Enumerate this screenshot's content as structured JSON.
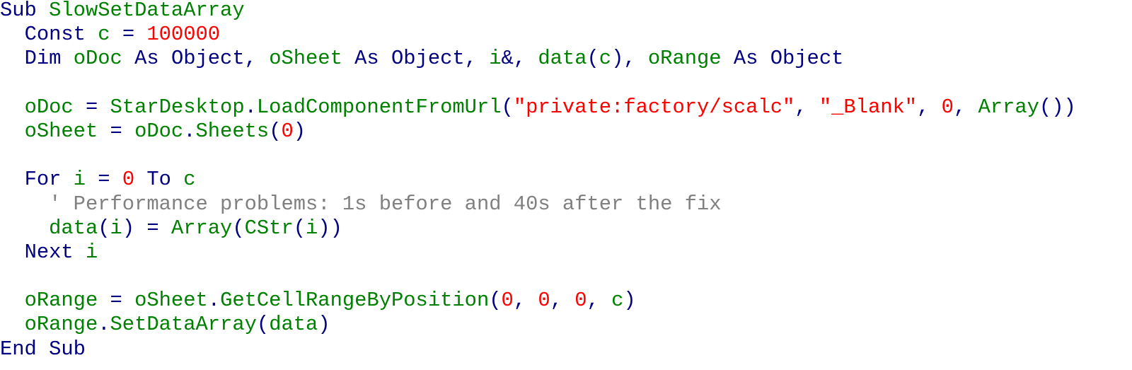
{
  "editor": {
    "language": "basic",
    "colors": {
      "keyword": "#000080",
      "identifier": "#008000",
      "number": "#ff0000",
      "string": "#ff0000",
      "operator": "#000080",
      "comment": "#808080"
    },
    "lines": [
      {
        "indent": "",
        "tokens": [
          [
            "kw",
            "Sub"
          ],
          [
            "pl",
            " "
          ],
          [
            "id",
            "SlowSetDataArray"
          ]
        ]
      },
      {
        "indent": "  ",
        "tokens": [
          [
            "kw",
            "Const"
          ],
          [
            "pl",
            " "
          ],
          [
            "id",
            "c"
          ],
          [
            "pl",
            " "
          ],
          [
            "op",
            "="
          ],
          [
            "pl",
            " "
          ],
          [
            "num",
            "100000"
          ]
        ]
      },
      {
        "indent": "  ",
        "tokens": [
          [
            "kw",
            "Dim"
          ],
          [
            "pl",
            " "
          ],
          [
            "id",
            "oDoc"
          ],
          [
            "pl",
            " "
          ],
          [
            "kw",
            "As"
          ],
          [
            "pl",
            " "
          ],
          [
            "kw",
            "Object"
          ],
          [
            "op",
            ","
          ],
          [
            "pl",
            " "
          ],
          [
            "id",
            "oSheet"
          ],
          [
            "pl",
            " "
          ],
          [
            "kw",
            "As"
          ],
          [
            "pl",
            " "
          ],
          [
            "kw",
            "Object"
          ],
          [
            "op",
            ","
          ],
          [
            "pl",
            " "
          ],
          [
            "id",
            "i"
          ],
          [
            "op",
            "&"
          ],
          [
            "op",
            ","
          ],
          [
            "pl",
            " "
          ],
          [
            "id",
            "data"
          ],
          [
            "op",
            "("
          ],
          [
            "id",
            "c"
          ],
          [
            "op",
            ")"
          ],
          [
            "op",
            ","
          ],
          [
            "pl",
            " "
          ],
          [
            "id",
            "oRange"
          ],
          [
            "pl",
            " "
          ],
          [
            "kw",
            "As"
          ],
          [
            "pl",
            " "
          ],
          [
            "kw",
            "Object"
          ]
        ]
      },
      {
        "indent": "",
        "tokens": []
      },
      {
        "indent": "  ",
        "tokens": [
          [
            "id",
            "oDoc"
          ],
          [
            "pl",
            " "
          ],
          [
            "op",
            "="
          ],
          [
            "pl",
            " "
          ],
          [
            "id",
            "StarDesktop"
          ],
          [
            "op",
            "."
          ],
          [
            "id",
            "LoadComponentFromUrl"
          ],
          [
            "op",
            "("
          ],
          [
            "str",
            "\"private:factory/scalc\""
          ],
          [
            "op",
            ","
          ],
          [
            "pl",
            " "
          ],
          [
            "str",
            "\"_Blank\""
          ],
          [
            "op",
            ","
          ],
          [
            "pl",
            " "
          ],
          [
            "num",
            "0"
          ],
          [
            "op",
            ","
          ],
          [
            "pl",
            " "
          ],
          [
            "id",
            "Array"
          ],
          [
            "op",
            "("
          ],
          [
            "op",
            ")"
          ],
          [
            "op",
            ")"
          ]
        ]
      },
      {
        "indent": "  ",
        "tokens": [
          [
            "id",
            "oSheet"
          ],
          [
            "pl",
            " "
          ],
          [
            "op",
            "="
          ],
          [
            "pl",
            " "
          ],
          [
            "id",
            "oDoc"
          ],
          [
            "op",
            "."
          ],
          [
            "id",
            "Sheets"
          ],
          [
            "op",
            "("
          ],
          [
            "num",
            "0"
          ],
          [
            "op",
            ")"
          ]
        ]
      },
      {
        "indent": "",
        "tokens": []
      },
      {
        "indent": "  ",
        "tokens": [
          [
            "kw",
            "For"
          ],
          [
            "pl",
            " "
          ],
          [
            "id",
            "i"
          ],
          [
            "pl",
            " "
          ],
          [
            "op",
            "="
          ],
          [
            "pl",
            " "
          ],
          [
            "num",
            "0"
          ],
          [
            "pl",
            " "
          ],
          [
            "kw",
            "To"
          ],
          [
            "pl",
            " "
          ],
          [
            "id",
            "c"
          ]
        ]
      },
      {
        "indent": "    ",
        "tokens": [
          [
            "cm",
            "' Performance problems: 1s before and 40s after the fix"
          ]
        ]
      },
      {
        "indent": "    ",
        "tokens": [
          [
            "id",
            "data"
          ],
          [
            "op",
            "("
          ],
          [
            "id",
            "i"
          ],
          [
            "op",
            ")"
          ],
          [
            "pl",
            " "
          ],
          [
            "op",
            "="
          ],
          [
            "pl",
            " "
          ],
          [
            "id",
            "Array"
          ],
          [
            "op",
            "("
          ],
          [
            "id",
            "CStr"
          ],
          [
            "op",
            "("
          ],
          [
            "id",
            "i"
          ],
          [
            "op",
            ")"
          ],
          [
            "op",
            ")"
          ]
        ]
      },
      {
        "indent": "  ",
        "tokens": [
          [
            "kw",
            "Next"
          ],
          [
            "pl",
            " "
          ],
          [
            "id",
            "i"
          ]
        ]
      },
      {
        "indent": "",
        "tokens": []
      },
      {
        "indent": "  ",
        "tokens": [
          [
            "id",
            "oRange"
          ],
          [
            "pl",
            " "
          ],
          [
            "op",
            "="
          ],
          [
            "pl",
            " "
          ],
          [
            "id",
            "oSheet"
          ],
          [
            "op",
            "."
          ],
          [
            "id",
            "GetCellRangeByPosition"
          ],
          [
            "op",
            "("
          ],
          [
            "num",
            "0"
          ],
          [
            "op",
            ","
          ],
          [
            "pl",
            " "
          ],
          [
            "num",
            "0"
          ],
          [
            "op",
            ","
          ],
          [
            "pl",
            " "
          ],
          [
            "num",
            "0"
          ],
          [
            "op",
            ","
          ],
          [
            "pl",
            " "
          ],
          [
            "id",
            "c"
          ],
          [
            "op",
            ")"
          ]
        ]
      },
      {
        "indent": "  ",
        "tokens": [
          [
            "id",
            "oRange"
          ],
          [
            "op",
            "."
          ],
          [
            "id",
            "SetDataArray"
          ],
          [
            "op",
            "("
          ],
          [
            "id",
            "data"
          ],
          [
            "op",
            ")"
          ]
        ]
      },
      {
        "indent": "",
        "tokens": [
          [
            "kw",
            "End"
          ],
          [
            "pl",
            " "
          ],
          [
            "kw",
            "Sub"
          ]
        ]
      }
    ]
  }
}
